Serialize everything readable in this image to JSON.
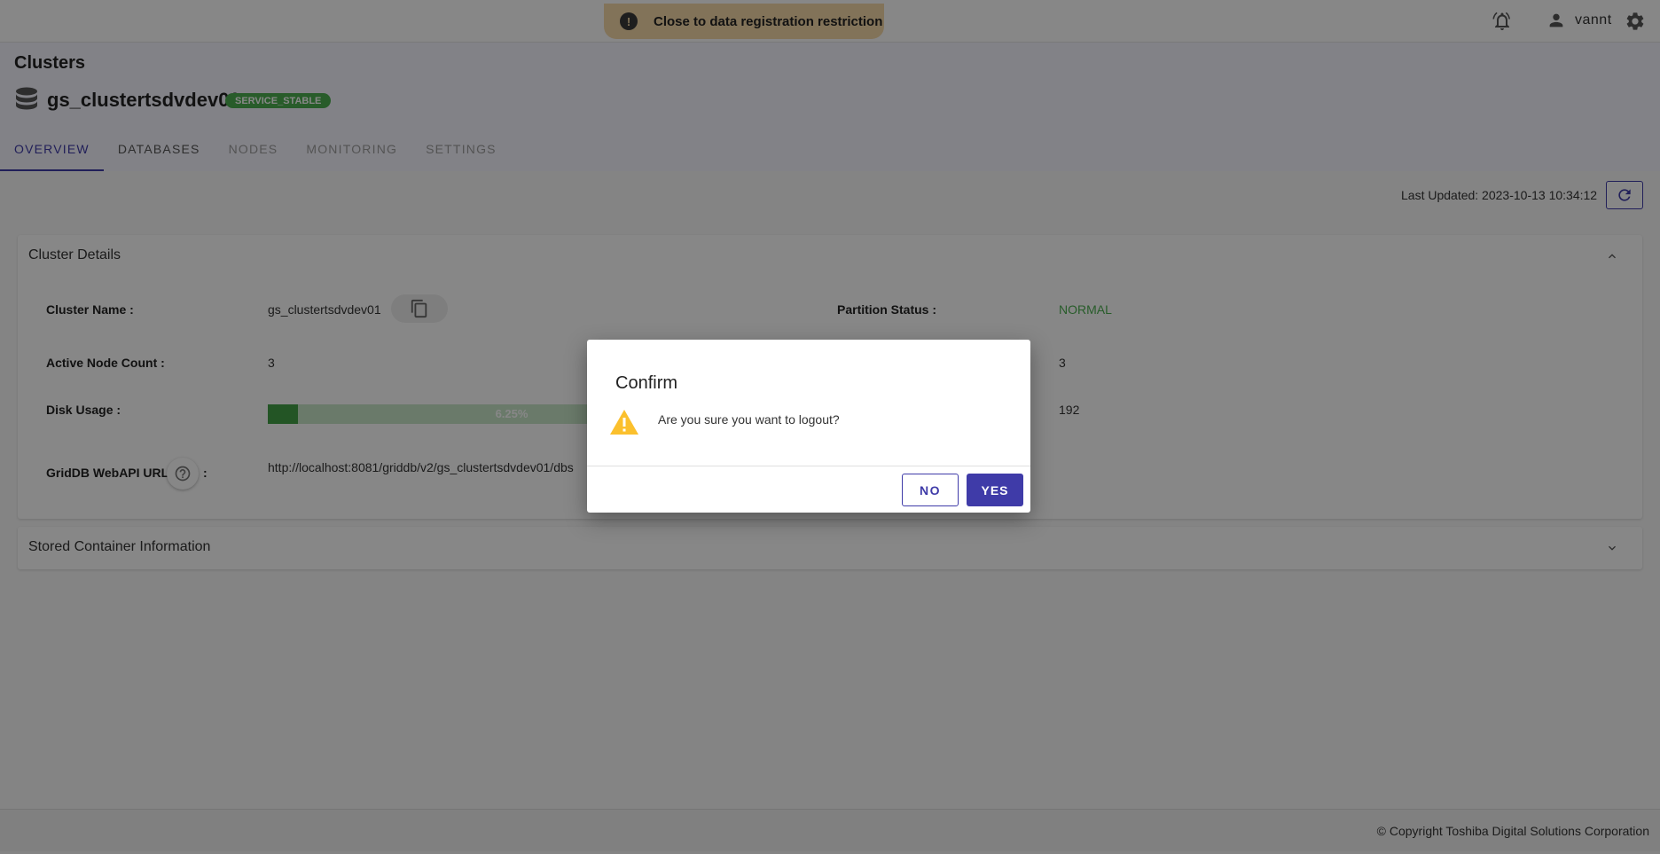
{
  "topbar": {
    "banner_text": "Close to data registration restriction",
    "banner_icon": "exclamation-icon",
    "username": "vannt",
    "icons": [
      "bell-icon",
      "user-icon",
      "gear-icon"
    ]
  },
  "header": {
    "page_title": "Clusters",
    "cluster_name": "gs_clustertsdvdev01",
    "status_badge": "SERVICE_STABLE",
    "status_color": "#4caf50"
  },
  "tabs": [
    {
      "label": "OVERVIEW",
      "active": true
    },
    {
      "label": "DATABASES",
      "active": false
    },
    {
      "label": "NODES",
      "active": false
    },
    {
      "label": "MONITORING",
      "active": false
    },
    {
      "label": "SETTINGS",
      "active": false
    }
  ],
  "last_updated": {
    "label": "Last Updated: 2023-10-13 10:34:12"
  },
  "cluster_details": {
    "title": "Cluster Details",
    "cluster_name_label": "Cluster Name :",
    "cluster_name_value": "gs_clustertsdvdev01",
    "partition_status_label": "Partition Status :",
    "partition_status_value": "NORMAL",
    "partition_status_color": "#4caf50",
    "active_node_label": "Active Node Count :",
    "active_node_value": "3",
    "right_value_2": "3",
    "disk_usage_label": "Disk Usage :",
    "disk_usage_text": "6.25%",
    "disk_usage_fraction": 0.0625,
    "right_value_3": "192",
    "webapi_label": "GridDB WebAPI URL",
    "webapi_colon": ":",
    "webapi_value": "http://localhost:8081/griddb/v2/gs_clustertsdvdev01/dbs"
  },
  "stored_container": {
    "title": "Stored Container Information"
  },
  "footer": {
    "copyright": "© Copyright Toshiba Digital Solutions Corporation"
  },
  "dialog": {
    "title": "Confirm",
    "message": "Are you sure you want to logout?",
    "no_label": "NO",
    "yes_label": "YES",
    "accent": "#3f3ba8"
  }
}
